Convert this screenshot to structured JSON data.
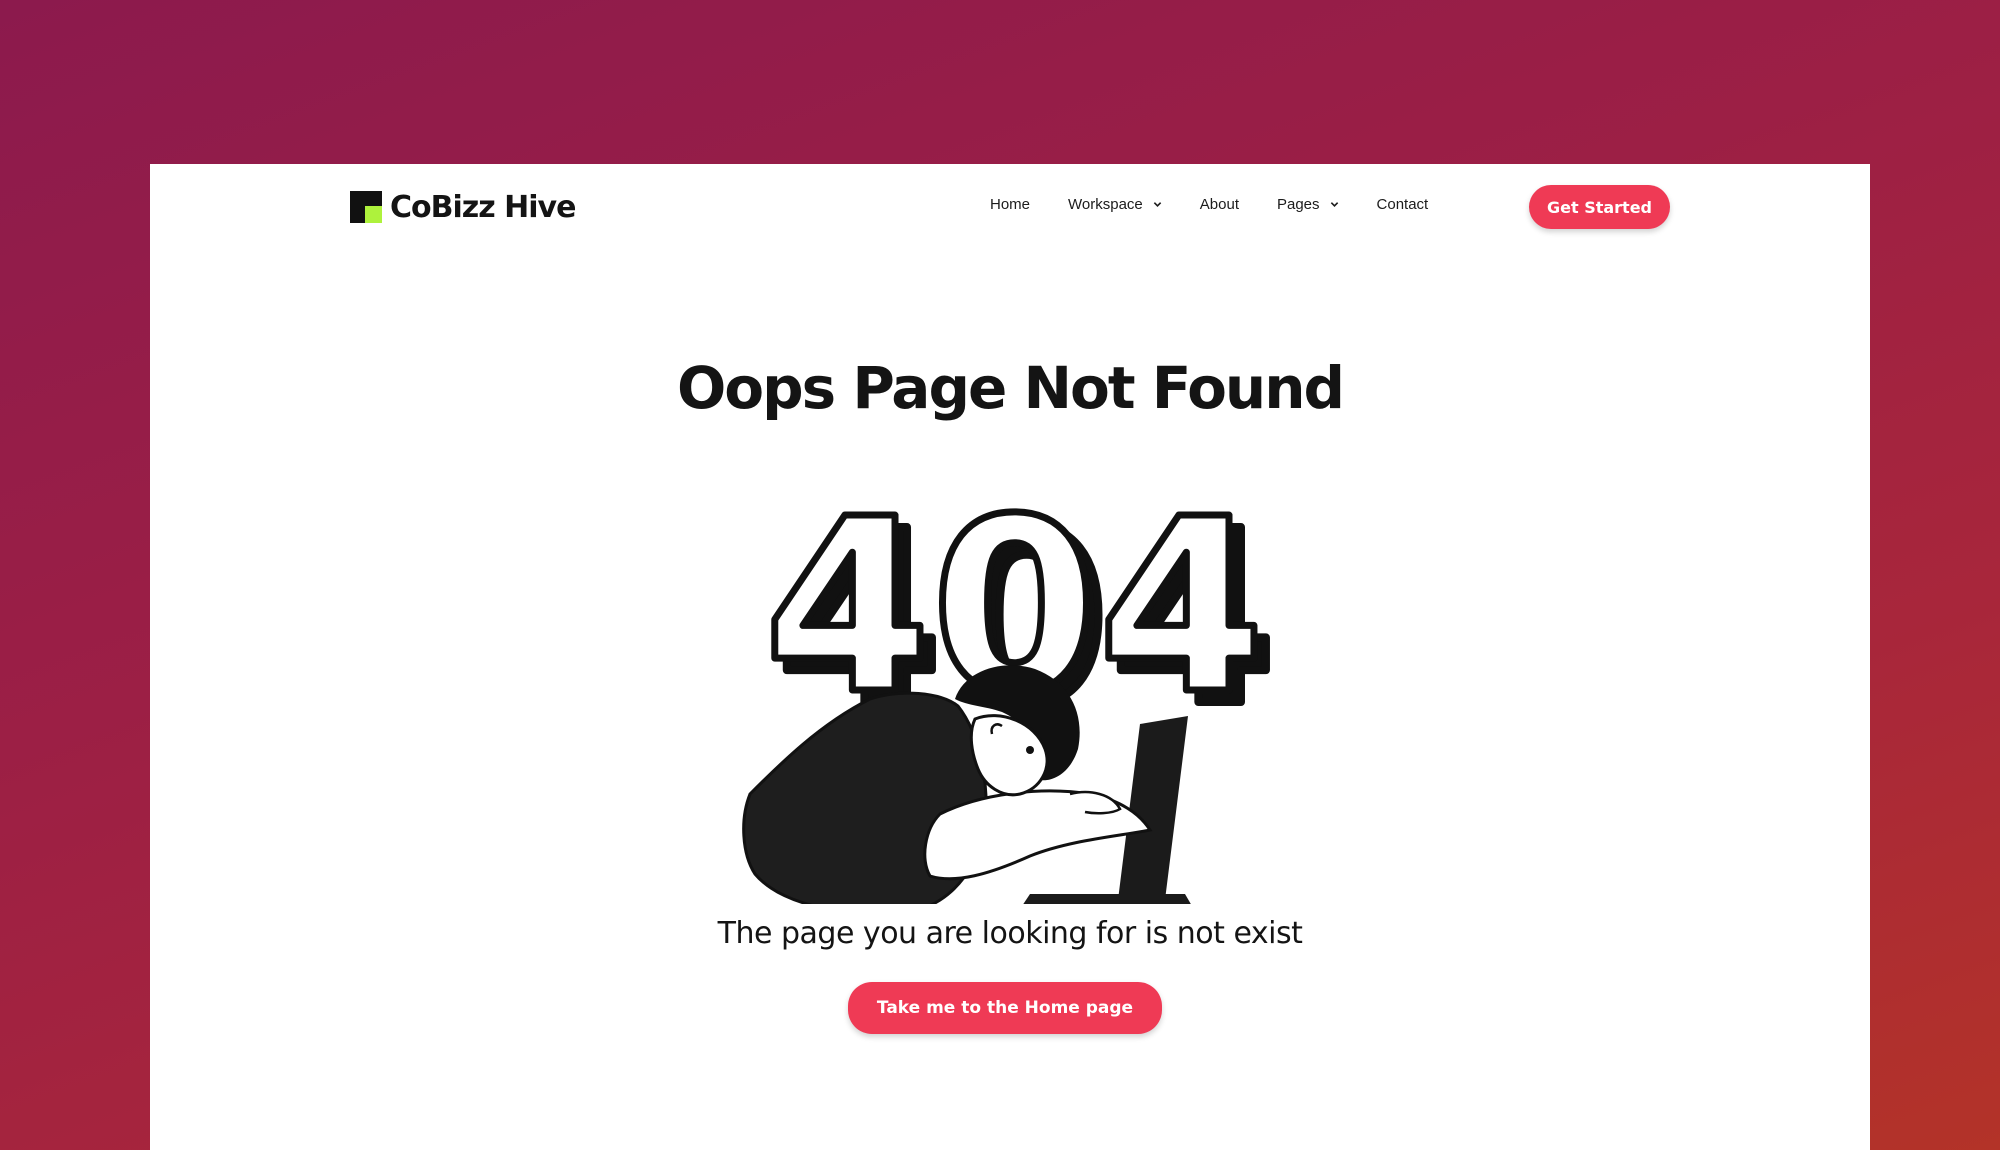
{
  "brand": {
    "name": "CoBizz Hive",
    "accent": "#ef3a55",
    "logo_green": "#aef23c"
  },
  "nav": {
    "items": [
      {
        "label": "Home",
        "has_dropdown": false
      },
      {
        "label": "Workspace",
        "has_dropdown": true
      },
      {
        "label": "About",
        "has_dropdown": false
      },
      {
        "label": "Pages",
        "has_dropdown": true
      },
      {
        "label": "Contact",
        "has_dropdown": false
      }
    ],
    "cta_label": "Get Started"
  },
  "hero": {
    "title": "Oops Page Not Found",
    "illustration_digits": "404",
    "subtitle": "The page you are looking for is not exist",
    "home_button_label": "Take me to the Home page"
  }
}
